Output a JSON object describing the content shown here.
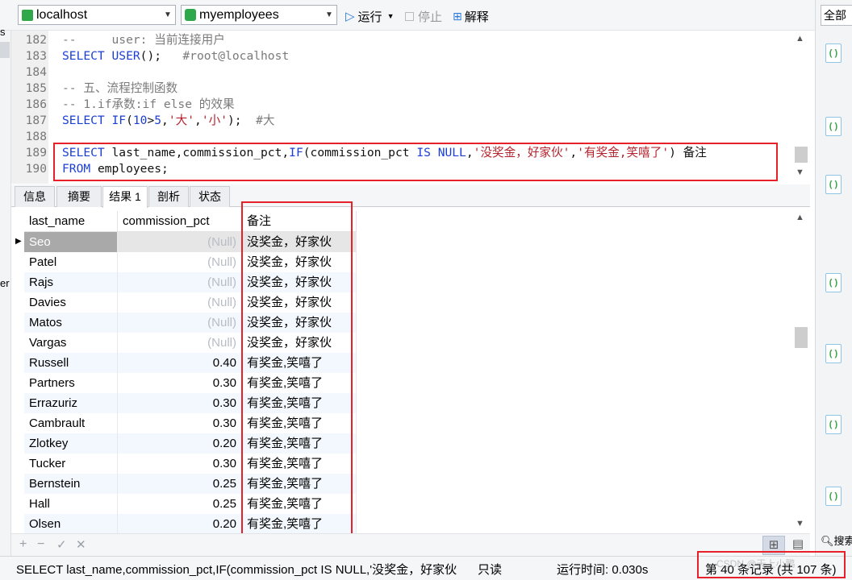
{
  "toolbar": {
    "connection": "localhost",
    "database": "myemployees",
    "run": "运行",
    "stop": "停止",
    "explain": "解释"
  },
  "right_panel": {
    "header": "全部",
    "search": "搜索"
  },
  "left_strip": {
    "top_char": "s",
    "mid_char": "er"
  },
  "editor": {
    "lines": [
      {
        "n": "182",
        "segs": [
          [
            "cm",
            "--     user: 当前连接用户"
          ]
        ]
      },
      {
        "n": "183",
        "segs": [
          [
            "kw",
            "SELECT USER"
          ],
          [
            "pl",
            "();   "
          ],
          [
            "cm",
            "#root@localhost"
          ]
        ]
      },
      {
        "n": "184",
        "segs": []
      },
      {
        "n": "185",
        "segs": [
          [
            "cm",
            "-- 五、流程控制函数"
          ]
        ]
      },
      {
        "n": "186",
        "segs": [
          [
            "cm",
            "-- 1.if承数:if else 的效果"
          ]
        ]
      },
      {
        "n": "187",
        "segs": [
          [
            "kw",
            "SELECT IF"
          ],
          [
            "pl",
            "("
          ],
          [
            "num",
            "10"
          ],
          [
            "pl",
            ">"
          ],
          [
            "num",
            "5"
          ],
          [
            "pl",
            ","
          ],
          [
            "str",
            "'大'"
          ],
          [
            "pl",
            ","
          ],
          [
            "str",
            "'小'"
          ],
          [
            "pl",
            ");  "
          ],
          [
            "cm",
            "#大"
          ]
        ]
      },
      {
        "n": "188",
        "segs": []
      },
      {
        "n": "189",
        "segs": [
          [
            "kw",
            "SELECT "
          ],
          [
            "pl",
            "last_name,commission_pct,"
          ],
          [
            "kw",
            "IF"
          ],
          [
            "pl",
            "(commission_pct "
          ],
          [
            "kw",
            "IS NULL"
          ],
          [
            "pl",
            ","
          ],
          [
            "str",
            "'没奖金，好家伙'"
          ],
          [
            "pl",
            ","
          ],
          [
            "str",
            "'有奖金,笑嘻了'"
          ],
          [
            "pl",
            ") 备注"
          ]
        ]
      },
      {
        "n": "190",
        "segs": [
          [
            "kw",
            "FROM "
          ],
          [
            "pl",
            "employees;"
          ]
        ]
      }
    ]
  },
  "tabs": [
    "信息",
    "摘要",
    "结果 1",
    "剖析",
    "状态"
  ],
  "active_tab": 2,
  "grid": {
    "columns": [
      "last_name",
      "commission_pct",
      "备注"
    ],
    "rows": [
      [
        "Seo",
        "(Null)",
        "没奖金，好家伙"
      ],
      [
        "Patel",
        "(Null)",
        "没奖金，好家伙"
      ],
      [
        "Rajs",
        "(Null)",
        "没奖金，好家伙"
      ],
      [
        "Davies",
        "(Null)",
        "没奖金，好家伙"
      ],
      [
        "Matos",
        "(Null)",
        "没奖金，好家伙"
      ],
      [
        "Vargas",
        "(Null)",
        "没奖金，好家伙"
      ],
      [
        "Russell",
        "0.40",
        "有奖金,笑嘻了"
      ],
      [
        "Partners",
        "0.30",
        "有奖金,笑嘻了"
      ],
      [
        "Errazuriz",
        "0.30",
        "有奖金,笑嘻了"
      ],
      [
        "Cambrault",
        "0.30",
        "有奖金,笑嘻了"
      ],
      [
        "Zlotkey",
        "0.20",
        "有奖金,笑嘻了"
      ],
      [
        "Tucker",
        "0.30",
        "有奖金,笑嘻了"
      ],
      [
        "Bernstein",
        "0.25",
        "有奖金,笑嘻了"
      ],
      [
        "Hall",
        "0.25",
        "有奖金,笑嘻了"
      ],
      [
        "Olsen",
        "0.20",
        "有奖金,笑嘻了"
      ]
    ]
  },
  "gridbar": {
    "add": "+",
    "remove": "−",
    "confirm": "✓",
    "cancel": "✕"
  },
  "status": {
    "query": "SELECT last_name,commission_pct,IF(commission_pct IS NULL,'没奖金，好家伙",
    "readonly": "只读",
    "runtime": "运行时间: 0.030s",
    "records": "第 40 条记录 (共 107 条)",
    "watermark": "CSDN @天上小鹏"
  },
  "colors": {
    "keyword": "#1a3ed6",
    "comment": "#7a7a7a",
    "string": "#b4232d",
    "highlight": "#e8202a"
  }
}
